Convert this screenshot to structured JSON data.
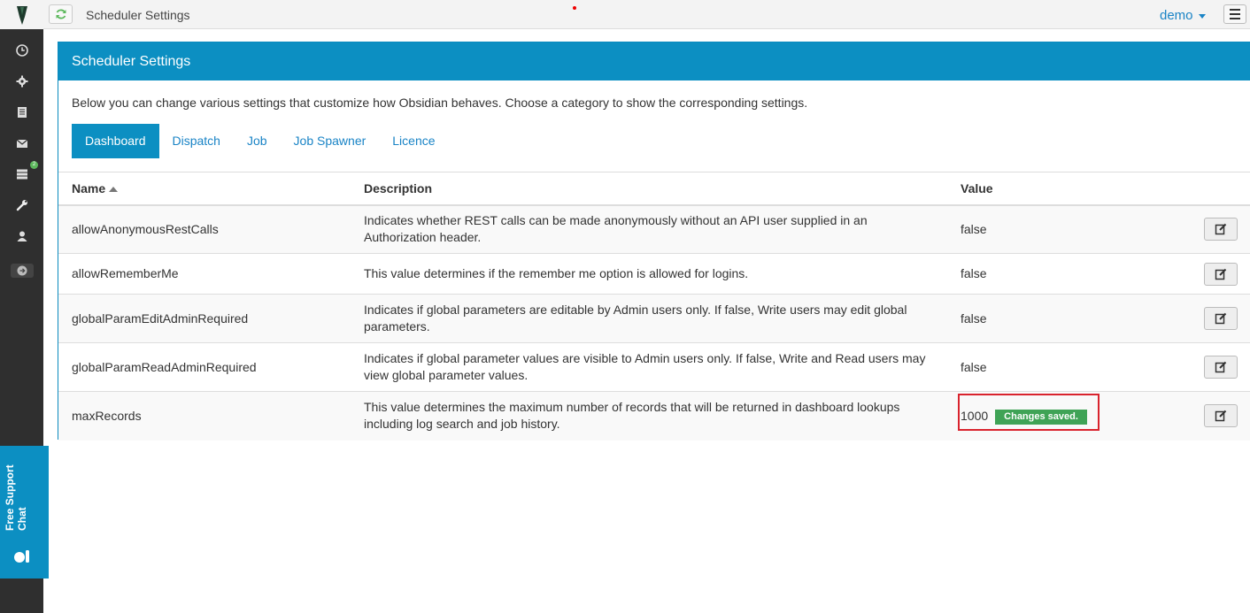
{
  "topbar": {
    "title": "Scheduler Settings",
    "user": "demo"
  },
  "sidebar": {
    "items": [
      {
        "icon": "clock-icon"
      },
      {
        "icon": "gear-icon"
      },
      {
        "icon": "document-icon"
      },
      {
        "icon": "envelope-icon"
      },
      {
        "icon": "server-icon",
        "badge": "2"
      },
      {
        "icon": "wrench-icon"
      },
      {
        "icon": "user-icon"
      }
    ]
  },
  "support": {
    "label": "Free Support Chat"
  },
  "panel": {
    "title": "Scheduler Settings",
    "intro": "Below you can change various settings that customize how Obsidian behaves. Choose a category to show the corresponding settings.",
    "tabs": [
      "Dashboard",
      "Dispatch",
      "Job",
      "Job Spawner",
      "Licence"
    ],
    "active_tab": "Dashboard"
  },
  "table": {
    "headers": {
      "name": "Name",
      "description": "Description",
      "value": "Value"
    },
    "rows": [
      {
        "name": "allowAnonymousRestCalls",
        "description": "Indicates whether REST calls can be made anonymously without an API user supplied in an Authorization header.",
        "value": "false"
      },
      {
        "name": "allowRememberMe",
        "description": "This value determines if the remember me option is allowed for logins.",
        "value": "false"
      },
      {
        "name": "globalParamEditAdminRequired",
        "description": "Indicates if global parameters are editable by Admin users only. If false, Write users may edit global parameters.",
        "value": "false"
      },
      {
        "name": "globalParamReadAdminRequired",
        "description": "Indicates if global parameter values are visible to Admin users only. If false, Write and Read users may view global parameter values.",
        "value": "false"
      },
      {
        "name": "maxRecords",
        "description": "This value determines the maximum number of records that will be returned in dashboard lookups including log search and job history.",
        "value": "1000",
        "status": "Changes saved."
      }
    ]
  },
  "colors": {
    "accent": "#0c8fc2",
    "sidebar": "#2f2f2f",
    "success": "#3fa356",
    "highlight": "#d9232d"
  }
}
